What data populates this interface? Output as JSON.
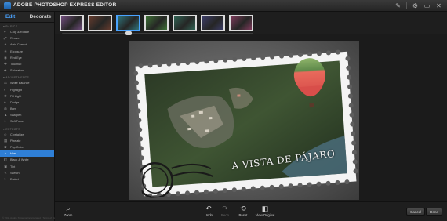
{
  "app": {
    "title": "ADOBE PHOTOSHOP EXPRESS EDITOR"
  },
  "titlebar_icons": [
    "pencil-icon",
    "gear-icon",
    "restore-icon",
    "close-icon"
  ],
  "modes": {
    "edit": "Edit",
    "decorate": "Decorate"
  },
  "sidebar": {
    "sections": [
      {
        "title": "BASICS",
        "items": [
          {
            "label": "Crop & Rotate",
            "icon": "crop-icon"
          },
          {
            "label": "Resize",
            "icon": "resize-icon"
          },
          {
            "label": "Auto Correct",
            "icon": "wand-icon"
          },
          {
            "label": "Exposure",
            "icon": "sun-icon"
          },
          {
            "label": "Red-Eye",
            "icon": "eye-icon"
          },
          {
            "label": "Touchup",
            "icon": "bandage-icon"
          },
          {
            "label": "Saturation",
            "icon": "droplet-icon"
          }
        ]
      },
      {
        "title": "ADJUSTMENTS",
        "items": [
          {
            "label": "White Balance",
            "icon": "balance-icon"
          },
          {
            "label": "Highlight",
            "icon": "highlight-icon"
          },
          {
            "label": "Fill Light",
            "icon": "bulb-icon"
          },
          {
            "label": "Dodge",
            "icon": "dodge-icon",
            "kbd": ""
          },
          {
            "label": "Burn",
            "icon": "burn-icon",
            "kbd": ""
          },
          {
            "label": "Sharpen",
            "icon": "sharpen-icon"
          },
          {
            "label": "Soft Focus",
            "icon": "soft-focus-icon"
          }
        ]
      },
      {
        "title": "EFFECTS",
        "items": [
          {
            "label": "Crystallize",
            "icon": "crystal-icon"
          },
          {
            "label": "Pixelate",
            "icon": "pixel-icon"
          },
          {
            "label": "Pop Color",
            "icon": "pop-color-icon"
          },
          {
            "label": "Hue",
            "icon": "hue-icon",
            "selected": true
          },
          {
            "label": "Black & White",
            "icon": "bw-icon"
          },
          {
            "label": "Tint",
            "icon": "tint-icon"
          },
          {
            "label": "Sketch",
            "icon": "sketch-icon"
          },
          {
            "label": "Distort",
            "icon": "distort-icon"
          }
        ]
      }
    ],
    "footer": "© 2011 Adobe Systems Incorporated · Terms of Use · Privacy Policy"
  },
  "thumbnails": {
    "count": 7,
    "selected_index": 2,
    "tints": [
      "#7a4f8a",
      "#6a3a2c",
      "#2d7c86",
      "#3e7a36",
      "#2f6a5a",
      "#3c3c70",
      "#8a3a62"
    ]
  },
  "canvas": {
    "caption": "A VISTA DE PÁJARO"
  },
  "bottom_tools": {
    "zoom": "Zoom",
    "undo": "Undo",
    "redo": "Redo",
    "reset": "Reset",
    "view_original": "View Original"
  },
  "actions": {
    "cancel": "Cancel",
    "done": "Done"
  },
  "colors": {
    "accent": "#2f7fd6",
    "selected_text": "#4aa3ff"
  }
}
